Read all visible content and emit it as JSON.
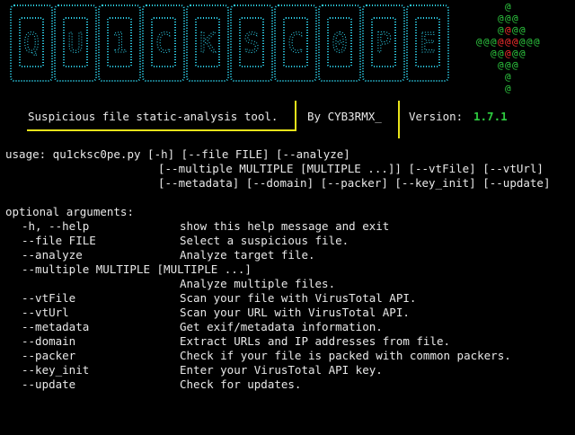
{
  "banner": {
    "art_text": "QU1CKSC0PE",
    "color": "#2fd6f0"
  },
  "crosshair": {
    "glyph": "@",
    "colors": {
      "outer": "#2ecc40",
      "center": "#ff3030"
    }
  },
  "info": {
    "description": "Suspicious file static-analysis tool.",
    "author": "By CYB3RMX_",
    "version_label": "Version:",
    "version_value": "1.7.1",
    "separator_color": "#e8e31a",
    "version_color": "#2ecc40"
  },
  "usage": {
    "line1": "usage: qu1cksc0pe.py [-h] [--file FILE] [--analyze]",
    "line2": "[--multiple MULTIPLE [MULTIPLE ...]] [--vtFile] [--vtUrl]",
    "line3": "[--metadata] [--domain] [--packer] [--key_init] [--update]"
  },
  "optional": {
    "header": "optional arguments:",
    "rows": [
      {
        "opt": "-h, --help",
        "desc": "show this help message and exit"
      },
      {
        "opt": "--file FILE",
        "desc": "Select a suspicious file."
      },
      {
        "opt": "--analyze",
        "desc": "Analyze target file."
      },
      {
        "opt": "--multiple MULTIPLE [MULTIPLE ...]",
        "desc": ""
      },
      {
        "opt": "",
        "desc": "Analyze multiple files."
      },
      {
        "opt": "--vtFile",
        "desc": "Scan your file with VirusTotal API."
      },
      {
        "opt": "--vtUrl",
        "desc": "Scan your URL with VirusTotal API."
      },
      {
        "opt": "--metadata",
        "desc": "Get exif/metadata information."
      },
      {
        "opt": "--domain",
        "desc": "Extract URLs and IP addresses from file."
      },
      {
        "opt": "--packer",
        "desc": "Check if your file is packed with common packers."
      },
      {
        "opt": "--key_init",
        "desc": "Enter your VirusTotal API key."
      },
      {
        "opt": "--update",
        "desc": "Check for updates."
      }
    ]
  }
}
